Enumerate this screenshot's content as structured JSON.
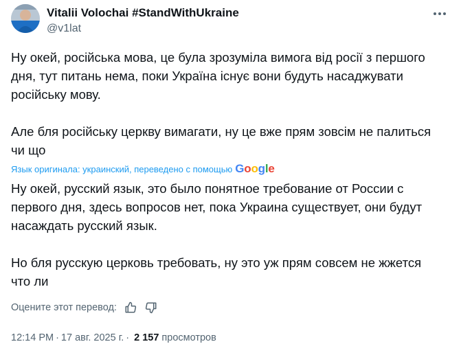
{
  "author": {
    "name": "Vitalii Volochai #StandWithUkraine",
    "handle": "@v1lat"
  },
  "tweet": {
    "original_text": "Ну окей, російська мова, це була зрозуміла вимога від росії з першого\nдня, тут питань нема, поки Україна існує вони будуть насаджувати\nросійську мову.\n\nАле бля російську церкву вимагати, ну це вже прям зовсім не палиться\nчи що",
    "translation_note": "Язык оригинала: украинский, переведено с помощью",
    "translation_provider": "Google",
    "translated_text": "Ну окей, русский язык, это было понятное требование от России с\nпервого дня, здесь вопросов нет, пока Украина существует, они будут\nнасаждать русский язык.\n\nНо бля русскую церковь требовать, ну это уж прям совсем не жжется\nчто ли"
  },
  "rating": {
    "label": "Оцените этот перевод:"
  },
  "meta": {
    "time": "12:14 PM",
    "separator": "·",
    "date": "17 авг. 2025 г.",
    "views_count": "2 157",
    "views_label": "просмотров"
  },
  "colors": {
    "text": "#0f1419",
    "secondary": "#536471",
    "link": "#1d9bf0"
  },
  "icons": {
    "more": "more-dots-icon",
    "like": "thumbs-up-icon",
    "dislike": "thumbs-down-icon"
  }
}
